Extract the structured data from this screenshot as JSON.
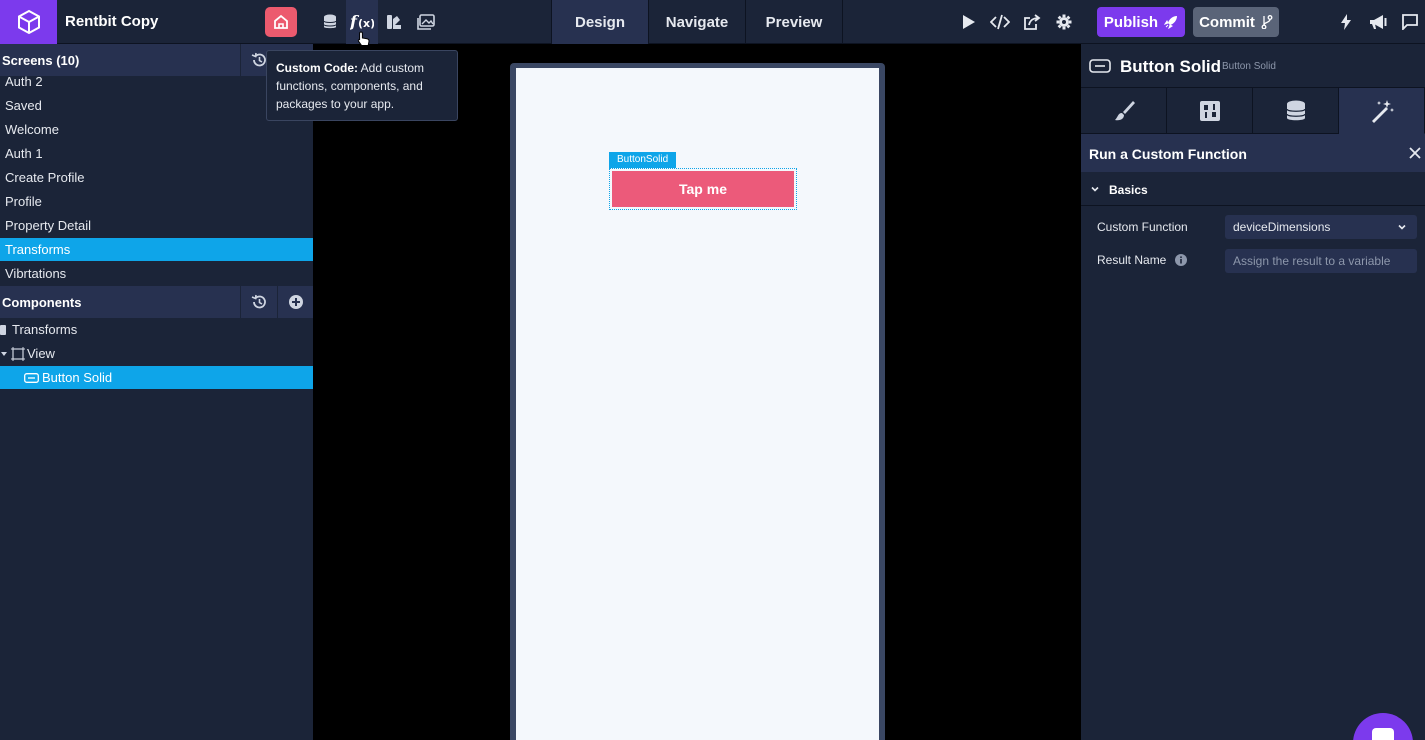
{
  "app": {
    "title": "Rentbit Copy"
  },
  "mode_tabs": [
    "Design",
    "Navigate",
    "Preview"
  ],
  "toolbar": {
    "publish_label": "Publish",
    "commit_label": "Commit"
  },
  "tooltip": {
    "title": "Custom Code:",
    "text": " Add custom functions, components, and packages to your app."
  },
  "screens": {
    "header": "Screens (10)",
    "items": [
      "Auth 2",
      "Saved",
      "Welcome",
      "Auth 1",
      "Create Profile",
      "Profile",
      "Property Detail",
      "Transforms",
      "Vibrtations"
    ],
    "selected": "Transforms"
  },
  "components": {
    "header": "Components",
    "tree": [
      {
        "label": "Transforms",
        "icon": "screen-icon"
      },
      {
        "label": "View",
        "icon": "view-frame-icon"
      },
      {
        "label": "Button Solid",
        "icon": "button-component-icon"
      }
    ]
  },
  "canvas": {
    "selection_label": "ButtonSolid",
    "button_text": "Tap me"
  },
  "inspector": {
    "component_title": "Button Solid",
    "component_subtitle": "Button Solid",
    "action_title": "Run a Custom Function",
    "section": "Basics",
    "fields": {
      "custom_function_label": "Custom Function",
      "custom_function_value": "deviceDimensions",
      "result_name_label": "Result Name",
      "result_name_placeholder": "Assign the result to a variable"
    }
  },
  "colors": {
    "accent": "#7c3aed",
    "selection": "#0ea5e9",
    "button": "#ec5a7a",
    "panel": "#1b2438"
  }
}
